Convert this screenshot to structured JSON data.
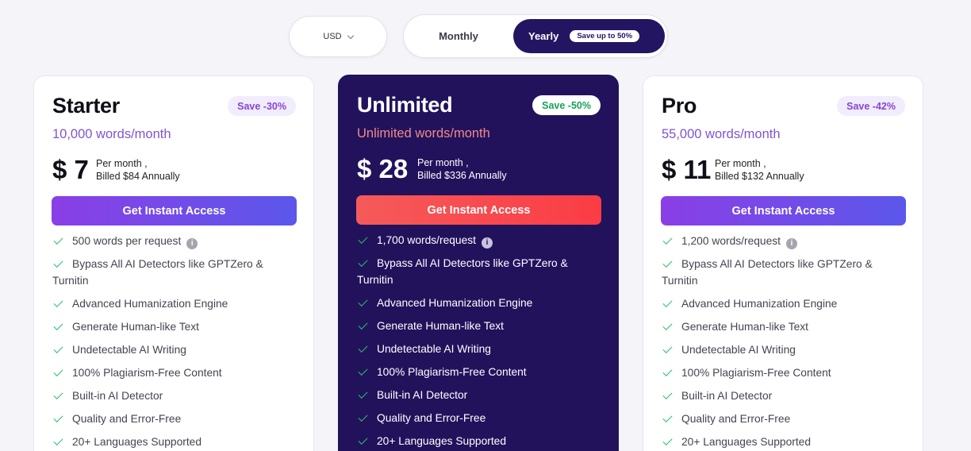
{
  "currency": {
    "label": "USD"
  },
  "billing": {
    "monthly_label": "Monthly",
    "yearly_label": "Yearly",
    "yearly_badge": "Save up to 50%",
    "selected": "Yearly"
  },
  "colors": {
    "accent_dark": "#22125c",
    "purple_cta": "#8a3fe6",
    "red_cta": "#fb3c45",
    "check": "#2bbf6b"
  },
  "plans": [
    {
      "name": "Starter",
      "badge": "Save -30%",
      "words": "10,000 words/month",
      "price": "$ 7",
      "per": "Per month ,",
      "billed": "Billed $84 Annually",
      "cta": "Get Instant Access",
      "features": [
        "500 words per request",
        "Bypass All AI Detectors like GPTZero & Turnitin",
        "Advanced Humanization Engine",
        "Generate Human-like Text",
        "Undetectable AI Writing",
        "100% Plagiarism-Free Content",
        "Built-in AI Detector",
        "Quality and Error-Free",
        "20+ Languages Supported"
      ]
    },
    {
      "name": "Unlimited",
      "badge": "Save -50%",
      "words": "Unlimited words/month",
      "price": "$ 28",
      "per": "Per month ,",
      "billed": "Billed $336 Annually",
      "cta": "Get Instant Access",
      "features": [
        "1,700 words/request",
        "Bypass All AI Detectors like GPTZero & Turnitin",
        "Advanced Humanization Engine",
        "Generate Human-like Text",
        "Undetectable AI Writing",
        "100% Plagiarism-Free Content",
        "Built-in AI Detector",
        "Quality and Error-Free",
        "20+ Languages Supported"
      ]
    },
    {
      "name": "Pro",
      "badge": "Save -42%",
      "words": "55,000 words/month",
      "price": "$ 11",
      "per": "Per month ,",
      "billed": "Billed $132 Annually",
      "cta": "Get Instant Access",
      "features": [
        "1,200 words/request",
        "Bypass All AI Detectors like GPTZero & Turnitin",
        "Advanced Humanization Engine",
        "Generate Human-like Text",
        "Undetectable AI Writing",
        "100% Plagiarism-Free Content",
        "Built-in AI Detector",
        "Quality and Error-Free",
        "20+ Languages Supported"
      ]
    }
  ]
}
